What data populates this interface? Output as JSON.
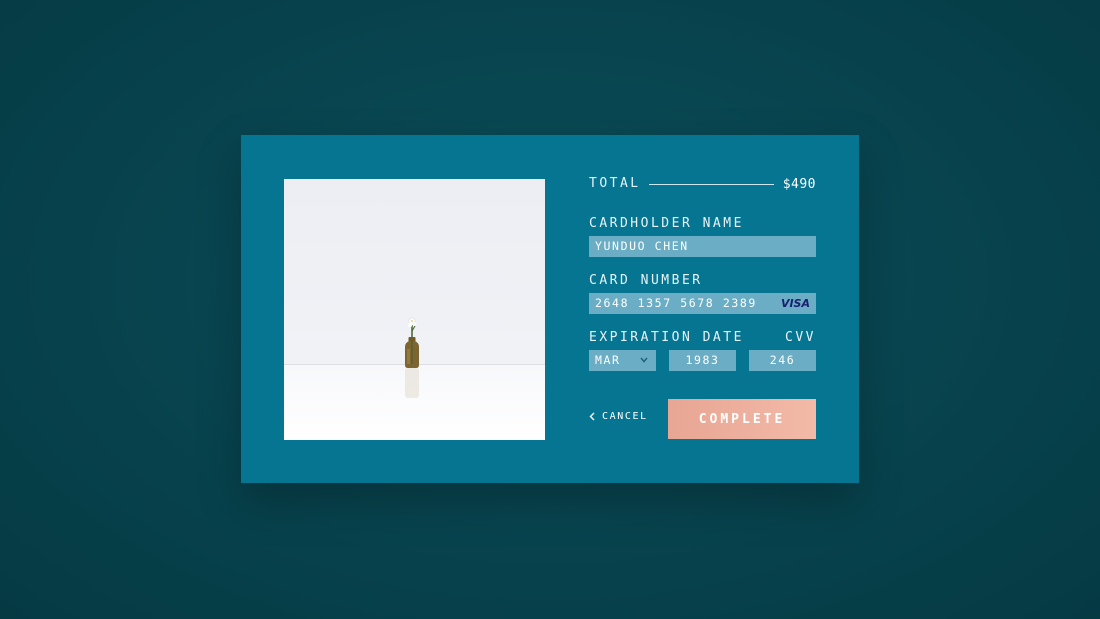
{
  "summary": {
    "total_label": "TOTAL",
    "total_value": "$490"
  },
  "product": {
    "image_icon": "bottle-with-flower"
  },
  "cardholder": {
    "label": "CARDHOLDER NAME",
    "value": "YUNDUO CHEN"
  },
  "card_number": {
    "label": "CARD NUMBER",
    "value": "2648 1357 5678 2389",
    "brand": "VISA"
  },
  "expiration": {
    "label": "EXPIRATION DATE",
    "month": "MAR",
    "year": "1983"
  },
  "cvv": {
    "label": "CVV",
    "value": "246"
  },
  "actions": {
    "cancel_label": "CANCEL",
    "complete_label": "COMPLETE"
  },
  "colors": {
    "background": "#084550",
    "card": "#067592",
    "input": "#6aadc4",
    "accent": "#eeb09e",
    "visa_brand": "#1a1f71"
  }
}
